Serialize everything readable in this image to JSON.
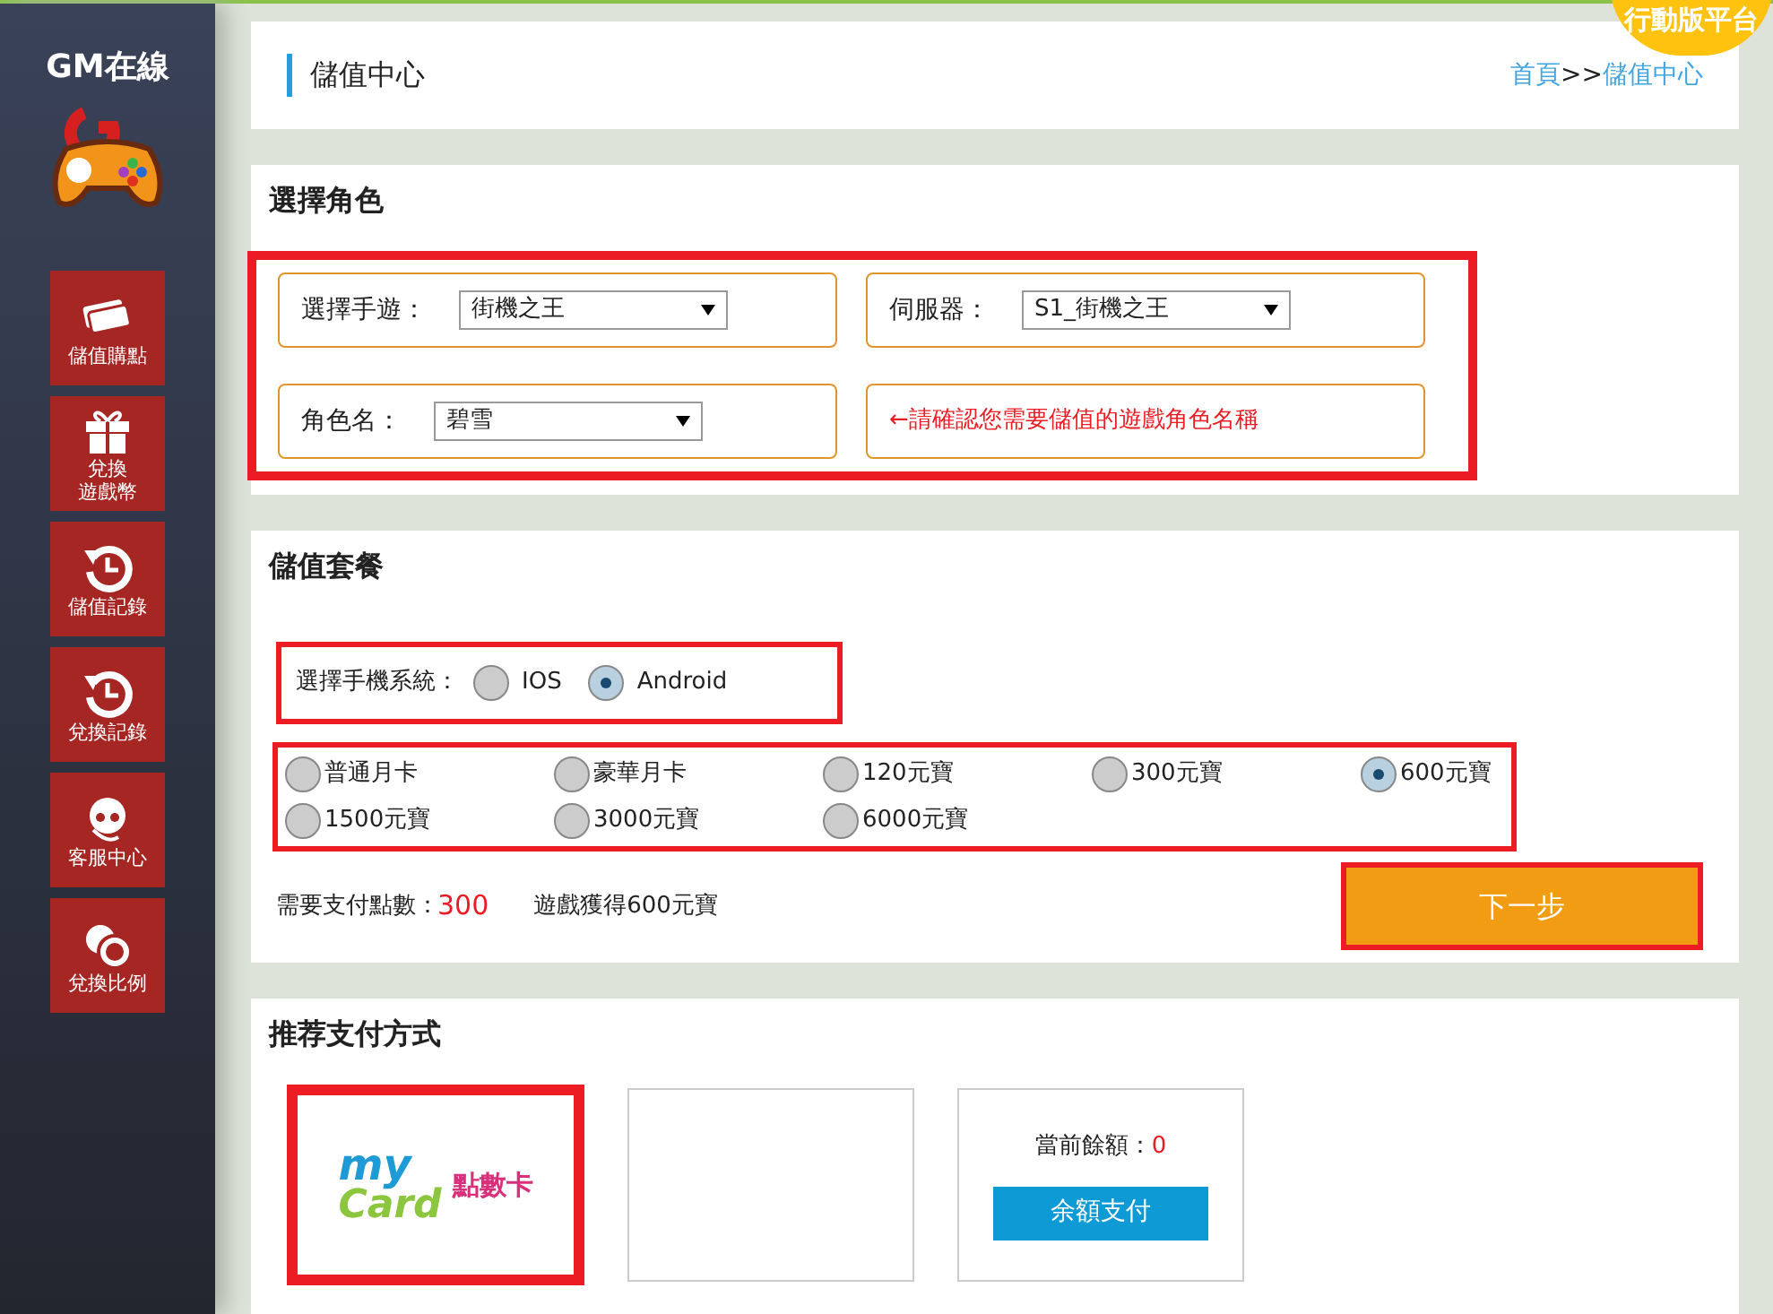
{
  "mobile_badge": "行動版平台",
  "sidebar": {
    "brand": "GM在線",
    "items": [
      {
        "lines": [
          "儲值購點"
        ]
      },
      {
        "lines": [
          "兌換",
          "遊戲幣"
        ]
      },
      {
        "lines": [
          "儲值記錄"
        ]
      },
      {
        "lines": [
          "兌換記錄"
        ]
      },
      {
        "lines": [
          "客服中心"
        ]
      },
      {
        "lines": [
          "兌換比例"
        ]
      }
    ]
  },
  "header": {
    "title": "儲值中心",
    "breadcrumb": [
      {
        "kind": "link",
        "text": "首頁"
      },
      {
        "kind": "sep",
        "text": ">>"
      },
      {
        "kind": "link",
        "text": "儲值中心"
      }
    ]
  },
  "role_section": {
    "title": "選擇角色",
    "highlighted": true,
    "fields": [
      {
        "kind": "select",
        "label": "選擇手遊：",
        "value": "街機之王"
      },
      {
        "kind": "select",
        "label": "伺服器：",
        "value": "S1_街機之王"
      },
      {
        "kind": "select",
        "label": "角色名：",
        "value": "碧雪"
      },
      {
        "kind": "note",
        "text": "←請確認您需要儲值的遊戲角色名稱"
      }
    ]
  },
  "package_section": {
    "title": "儲值套餐",
    "os": {
      "label": "選擇手機系統：",
      "highlighted": true,
      "options": [
        {
          "label": "IOS",
          "selected": false
        },
        {
          "label": "Android",
          "selected": true
        }
      ]
    },
    "packages_highlighted": true,
    "packages": [
      {
        "label": "普通月卡",
        "selected": false
      },
      {
        "label": "豪華月卡",
        "selected": false
      },
      {
        "label": "120元寶",
        "selected": false
      },
      {
        "label": "300元寶",
        "selected": false
      },
      {
        "label": "600元寶",
        "selected": true
      },
      {
        "label": "1500元寶",
        "selected": false
      },
      {
        "label": "3000元寶",
        "selected": false
      },
      {
        "label": "6000元寶",
        "selected": false
      }
    ],
    "pay_label": "需要支付點數：",
    "pay_amount": "300",
    "reward": "遊戲獲得600元寶",
    "next_button": {
      "label": "下一步",
      "highlighted": true
    }
  },
  "payment_section": {
    "title": "推荐支付方式",
    "methods": [
      {
        "kind": "mycard",
        "highlighted": true,
        "logo_words": [
          "my",
          "Card"
        ],
        "caption": "點數卡"
      },
      {
        "kind": "empty",
        "highlighted": false
      },
      {
        "kind": "balance",
        "highlighted": false,
        "label": "當前餘額：",
        "amount": "0",
        "button": "余額支付"
      }
    ]
  }
}
